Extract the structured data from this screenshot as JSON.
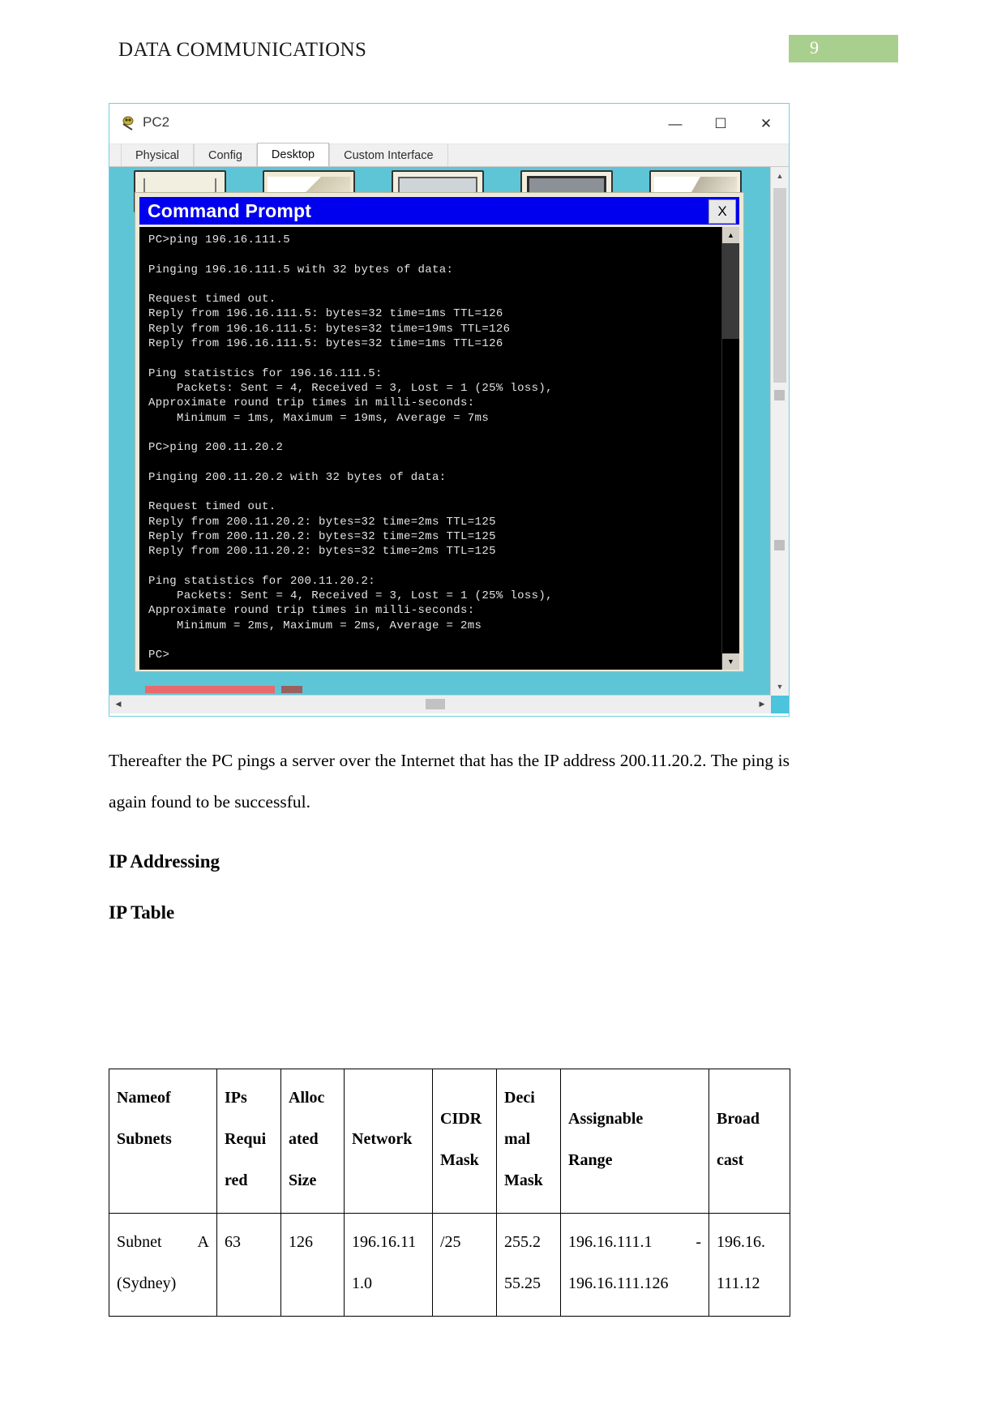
{
  "header": {
    "doc_title": "DATA COMMUNICATIONS",
    "page_number": "9"
  },
  "figure": {
    "pt_window": {
      "title": "PC2",
      "icon": "packet-tracer-pc-icon",
      "minimize": "—",
      "maximize": "☐",
      "close": "✕",
      "tabs": [
        {
          "label": "Physical",
          "active": false
        },
        {
          "label": "Config",
          "active": false
        },
        {
          "label": "Desktop",
          "active": true
        },
        {
          "label": "Custom Interface",
          "active": false
        }
      ]
    },
    "command_prompt": {
      "title": "Command Prompt",
      "close_label": "X",
      "terminal_text": "PC>ping 196.16.111.5\n\nPinging 196.16.111.5 with 32 bytes of data:\n\nRequest timed out.\nReply from 196.16.111.5: bytes=32 time=1ms TTL=126\nReply from 196.16.111.5: bytes=32 time=19ms TTL=126\nReply from 196.16.111.5: bytes=32 time=1ms TTL=126\n\nPing statistics for 196.16.111.5:\n    Packets: Sent = 4, Received = 3, Lost = 1 (25% loss),\nApproximate round trip times in milli-seconds:\n    Minimum = 1ms, Maximum = 19ms, Average = 7ms\n\nPC>ping 200.11.20.2\n\nPinging 200.11.20.2 with 32 bytes of data:\n\nRequest timed out.\nReply from 200.11.20.2: bytes=32 time=2ms TTL=125\nReply from 200.11.20.2: bytes=32 time=2ms TTL=125\nReply from 200.11.20.2: bytes=32 time=2ms TTL=125\n\nPing statistics for 200.11.20.2:\n    Packets: Sent = 4, Received = 3, Lost = 1 (25% loss),\nApproximate round trip times in milli-seconds:\n    Minimum = 2ms, Maximum = 2ms, Average = 2ms\n\nPC>",
      "scroll_up_arrow": "▲",
      "scroll_down_arrow": "▼"
    },
    "scrollbars": {
      "up_arrow": "▲",
      "down_arrow": "▼",
      "left_arrow": "◀",
      "right_arrow": "▶"
    }
  },
  "body": {
    "paragraph_1": "Thereafter the PC pings a server over the Internet that has the IP address 200.11.20.2. The ping is again found to be successful.",
    "heading_1": "IP Addressing",
    "heading_2": "IP Table"
  },
  "ip_table": {
    "headers": [
      "Name of Subnets",
      "IPs Requi red",
      "Alloc ated Size",
      "Network",
      "CIDR Mask",
      "Deci mal Mask",
      "Assignable Range",
      "Broad cast"
    ],
    "header_parts": {
      "c0_l1": "Name",
      "c0_l2": "of",
      "c0_l3": "Subnets",
      "c1_l1": "IPs",
      "c1_l2": "Requi",
      "c1_l3": "red",
      "c2_l1": "Alloc",
      "c2_l2": "ated",
      "c2_l3": "Size",
      "c3_l1": "Network",
      "c4_l1": "CIDR",
      "c4_l2": "Mask",
      "c5_l1": "Deci",
      "c5_l2": "mal",
      "c5_l3": "Mask",
      "c6_l1": "Assignable",
      "c6_l2": "Range",
      "c7_l1": "Broad",
      "c7_l2": "cast"
    },
    "rows": [
      {
        "name_l1": "Subnet",
        "name_l2": "A",
        "name_l3": "(Sydney)",
        "ips_required": "63",
        "allocated_size": "126",
        "network_l1": "196.16.11",
        "network_l2": "1.0",
        "cidr_mask": "/25",
        "decimal_mask_l1": "255.2",
        "decimal_mask_l2": "55.25",
        "range_l1_start": "196.16.111.1",
        "range_l1_dash": "-",
        "range_l2": "196.16.111.126",
        "broadcast_l1": "196.16.",
        "broadcast_l2": "111.12"
      }
    ]
  }
}
